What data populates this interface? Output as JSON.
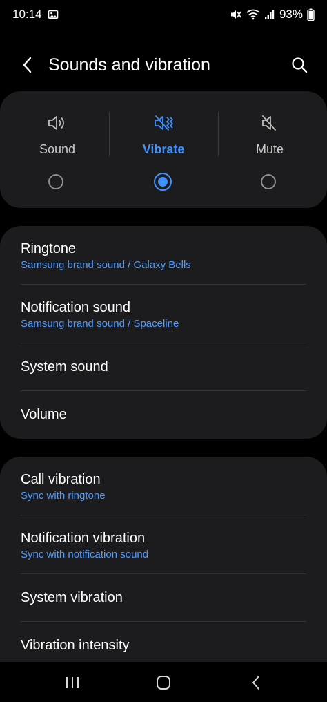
{
  "status_bar": {
    "time": "10:14",
    "battery": "93%",
    "icons": [
      "gallery-icon",
      "mute-vibrate-icon",
      "wifi-icon",
      "signal-icon",
      "battery-icon"
    ]
  },
  "header": {
    "title": "Sounds and vibration",
    "back_icon": "back-arrow-icon",
    "search_icon": "search-icon"
  },
  "sound_modes": {
    "selected": "Vibrate",
    "options": [
      {
        "label": "Sound",
        "icon": "speaker-icon",
        "selected": false
      },
      {
        "label": "Vibrate",
        "icon": "vibrate-icon",
        "selected": true
      },
      {
        "label": "Mute",
        "icon": "mute-icon",
        "selected": false
      }
    ]
  },
  "sound_settings": [
    {
      "title": "Ringtone",
      "subtitle": "Samsung brand sound / Galaxy Bells"
    },
    {
      "title": "Notification sound",
      "subtitle": "Samsung brand sound / Spaceline"
    },
    {
      "title": "System sound"
    },
    {
      "title": "Volume"
    }
  ],
  "vibration_settings": [
    {
      "title": "Call vibration",
      "subtitle": "Sync with ringtone"
    },
    {
      "title": "Notification vibration",
      "subtitle": "Sync with notification sound"
    },
    {
      "title": "System vibration"
    },
    {
      "title": "Vibration intensity"
    }
  ],
  "nav_bar": {
    "buttons": [
      "recents-icon",
      "home-icon",
      "back-icon"
    ]
  },
  "colors": {
    "accent": "#3e91ff",
    "subtitle": "#4f9bff",
    "card": "#1c1c1e",
    "background": "#000000"
  }
}
